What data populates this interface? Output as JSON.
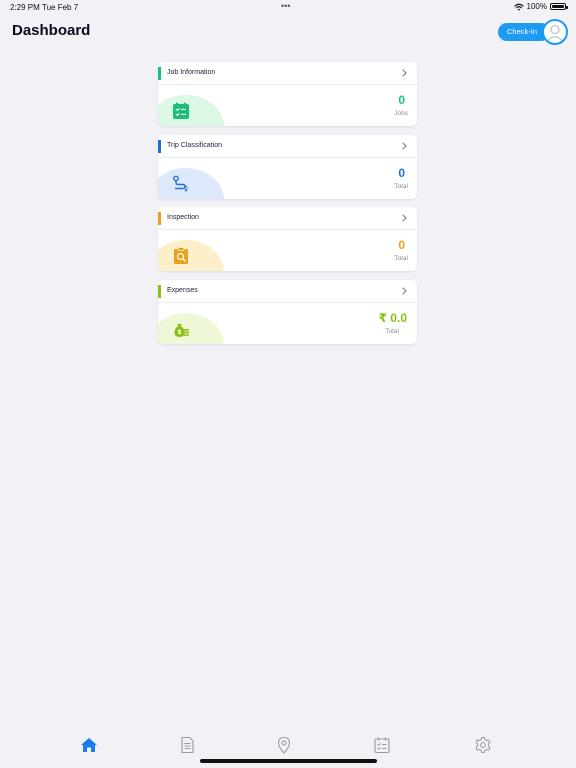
{
  "status_bar": {
    "time": "2:29 PM",
    "date": "Tue Feb 7",
    "battery": "100%"
  },
  "header": {
    "title": "Dashboard",
    "checkin_label": "Check-In"
  },
  "cards": [
    {
      "title": "Job Information",
      "value": "0",
      "unit": "Jobs",
      "accent": "#1cbf7a",
      "icon": "clipboard-check-icon"
    },
    {
      "title": "Trip Classification",
      "value": "0",
      "unit": "Total",
      "accent": "#1f6fd6",
      "icon": "route-icon"
    },
    {
      "title": "Inspection",
      "value": "0",
      "unit": "Total",
      "accent": "#e6a21c",
      "icon": "clipboard-search-icon"
    },
    {
      "title": "Expenses",
      "value": "₹ 0.0",
      "unit": "Total",
      "accent": "#8bbf17",
      "icon": "money-bag-icon"
    }
  ],
  "tabs": [
    {
      "name": "home",
      "icon": "home-icon",
      "active": true
    },
    {
      "name": "documents",
      "icon": "document-icon",
      "active": false
    },
    {
      "name": "location",
      "icon": "map-pin-icon",
      "active": false
    },
    {
      "name": "tasks",
      "icon": "calendar-check-icon",
      "active": false
    },
    {
      "name": "settings",
      "icon": "gear-icon",
      "active": false
    }
  ],
  "colors": {
    "background": "#f1f1f6",
    "primary": "#1d9bf0",
    "tab_active": "#1a7bf2",
    "tab_inactive": "#9a9aa6"
  }
}
